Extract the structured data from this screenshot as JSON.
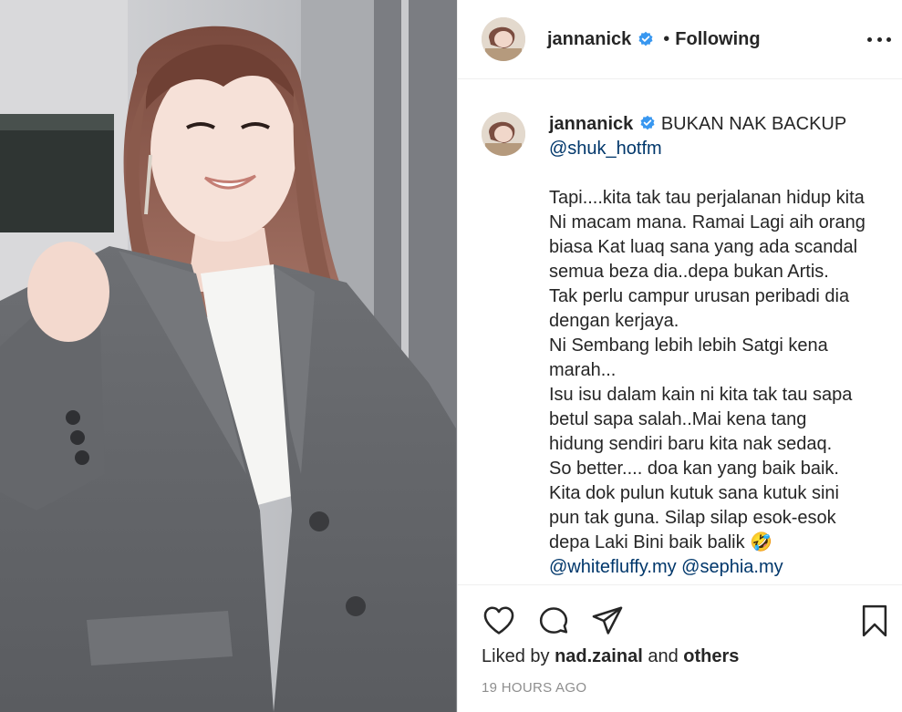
{
  "post": {
    "username": "jannanick",
    "separator": "•",
    "follow_status": "Following",
    "caption": {
      "username": "jannanick",
      "lines": [
        "BUKAN NAK BACKUP",
        "@shuk_hotfm",
        "",
        "Tapi....kita tak tau perjalanan hidup kita",
        "Ni macam mana. Ramai Lagi aih orang",
        "biasa Kat luaq sana yang ada scandal",
        "semua beza dia..depa bukan Artis.",
        "Tak perlu campur urusan peribadi dia",
        "dengan kerjaya.",
        "Ni Sembang lebih lebih Satgi kena",
        "marah...",
        "Isu isu dalam kain ni kita tak tau sapa",
        "betul sapa salah..Mai kena tang",
        "hidung sendiri baru kita nak sedaq.",
        "So better.... doa kan yang baik baik.",
        "Kita dok pulun kutuk sana kutuk sini",
        "pun tak guna. Silap silap esok-esok",
        "depa Laki Bini baik balik 🤣",
        "@whitefluffy.my @sephia.my"
      ]
    },
    "likes": {
      "prefix": "Liked by",
      "user": "nad.zainal",
      "conjunction": "and",
      "others": "others"
    },
    "timestamp": "19 HOURS AGO"
  },
  "icons": {
    "verified": "verified-badge-icon",
    "more": "more-options-icon",
    "like": "heart-icon",
    "comment": "comment-icon",
    "share": "share-icon",
    "save": "bookmark-icon"
  },
  "colors": {
    "verified_blue": "#3897f0",
    "mention": "#00376b",
    "text": "#262626",
    "muted": "#8e8e8e"
  }
}
